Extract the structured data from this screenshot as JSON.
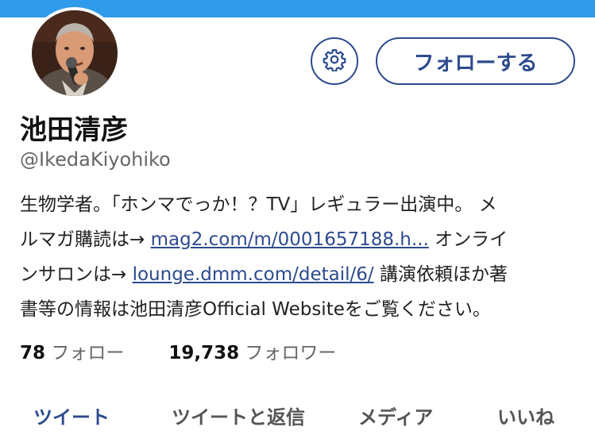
{
  "banner_color": "#2f9bea",
  "accent_color": "#2d4b8e",
  "profile": {
    "name": "池田清彦",
    "handle": "@IkedaKiyohiko"
  },
  "actions": {
    "settings_icon": "gear-icon",
    "follow_label": "フォローする"
  },
  "bio": {
    "line1": "生物学者。「ホンマでっか！？TV」レギュラー出演中。 メ",
    "line2_prefix": "ルマガ購読は→ ",
    "line2_link": "mag2.com/m/0001657188.h...",
    "line2_suffix": " オンライ",
    "line3_prefix": "ンサロンは→ ",
    "line3_link": "lounge.dmm.com/detail/6/",
    "line3_suffix": " 講演依頼ほか著",
    "line4": "書等の情報は池田清彦Official Websiteをご覧ください。"
  },
  "stats": {
    "following_count": "78",
    "following_label": "フォロー",
    "followers_count": "19,738",
    "followers_label": "フォロワー"
  },
  "tabs": [
    {
      "label": "ツイート",
      "active": true
    },
    {
      "label": "ツイートと返信",
      "active": false
    },
    {
      "label": "メディア",
      "active": false
    },
    {
      "label": "いいね",
      "active": false
    }
  ]
}
